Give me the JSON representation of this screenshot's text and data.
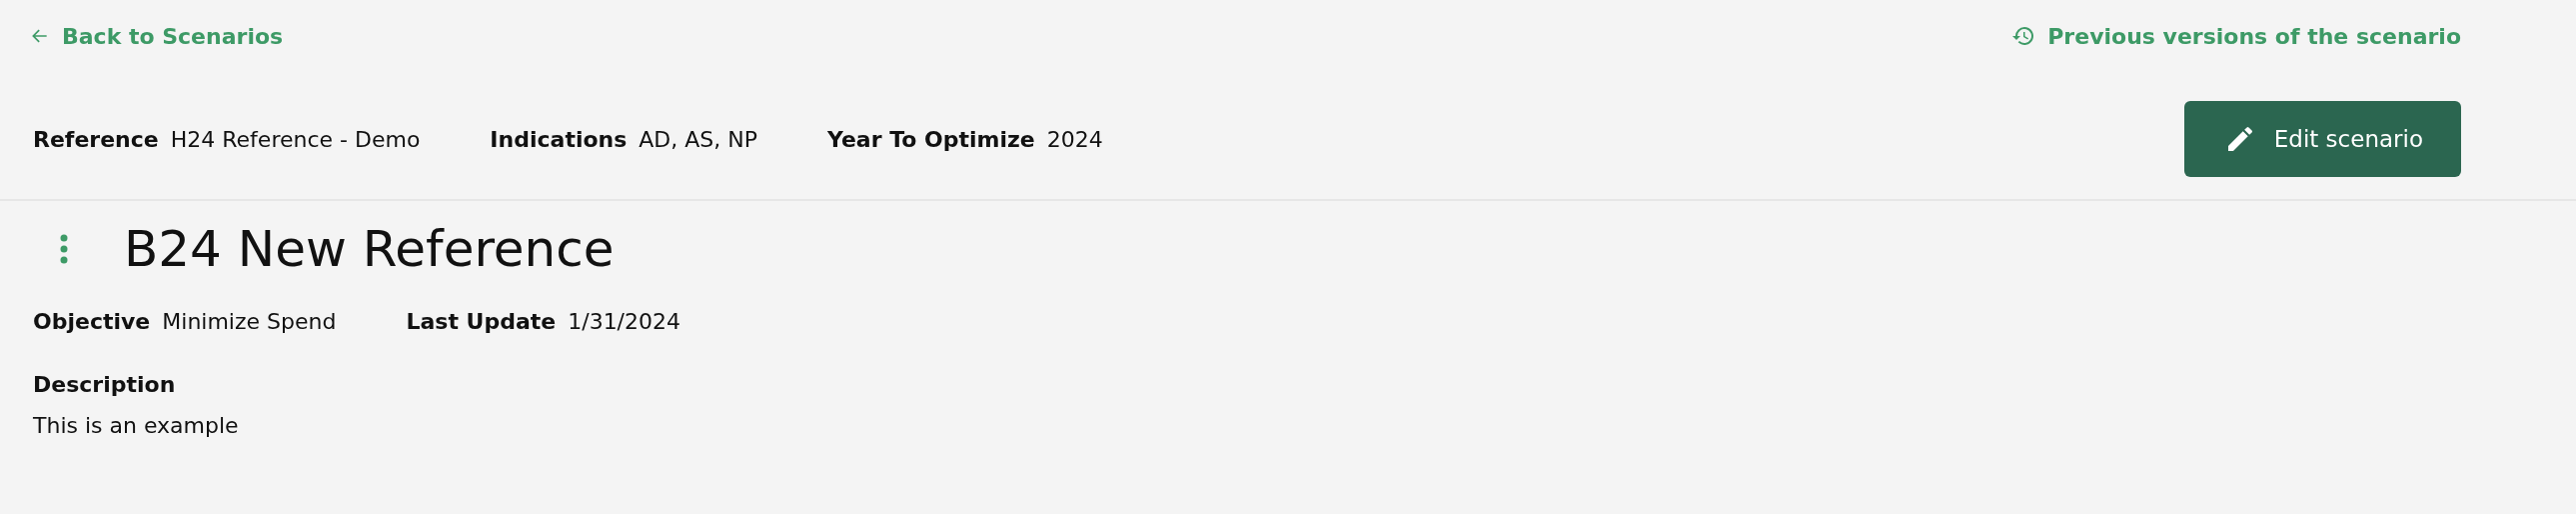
{
  "top_bar": {
    "back_link": "Back to Scenarios",
    "versions_link": "Previous versions of the scenario"
  },
  "reference_bar": {
    "fields": [
      {
        "label": "Reference",
        "value": "H24 Reference - Demo"
      },
      {
        "label": "Indications",
        "value": "AD, AS, NP"
      },
      {
        "label": "Year To Optimize",
        "value": "2024"
      }
    ],
    "edit_button": "Edit scenario"
  },
  "scenario": {
    "title": "B24 New Reference",
    "fields": [
      {
        "label": "Objective",
        "value": "Minimize Spend"
      },
      {
        "label": "Last Update",
        "value": "1/31/2024"
      }
    ],
    "description_label": "Description",
    "description": "This is an example"
  }
}
